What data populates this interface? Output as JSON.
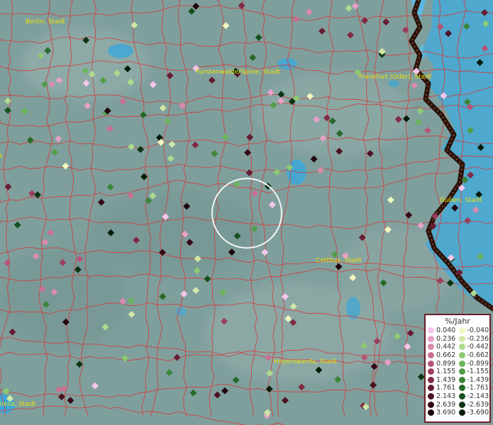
{
  "map": {
    "colors": {
      "land": "#7f9f9c",
      "water": "#3aa6d6",
      "boundary": "#d43b3b",
      "city_label": "#e8e010",
      "border_line": "#3a1810"
    },
    "city_labels": [
      {
        "name": "Berlin, Stadt"
      },
      {
        "name": "Fürstenwalde/Spree, Stadt"
      },
      {
        "name": "Frankfurt (Oder), Stadt"
      },
      {
        "name": "Guben, Stadt"
      },
      {
        "name": "Cottbus, Stadt"
      },
      {
        "name": "Hoyerswerda, Stadt"
      },
      {
        "name": "Riesa, Stadt"
      },
      {
        "name": "t"
      }
    ],
    "search_circle": {
      "style": "white ring"
    },
    "legend": {
      "title": "%/Jahr",
      "positive": [
        {
          "value": "0.040",
          "color": "#f7c6ec"
        },
        {
          "value": "0.236",
          "color": "#e6a0c7"
        },
        {
          "value": "0.442",
          "color": "#d98cb0"
        },
        {
          "value": "0.662",
          "color": "#c86f93"
        },
        {
          "value": "0.899",
          "color": "#b45578"
        },
        {
          "value": "1.155",
          "color": "#9c3e5e"
        },
        {
          "value": "1.439",
          "color": "#812a46"
        },
        {
          "value": "1.761",
          "color": "#661c33"
        },
        {
          "value": "2.143",
          "color": "#4c1123"
        },
        {
          "value": "2.639",
          "color": "#330816"
        },
        {
          "value": "3.690",
          "color": "#1d030a"
        }
      ],
      "negative": [
        {
          "value": "-0.040",
          "color": "#f1f7c0"
        },
        {
          "value": "-0.236",
          "color": "#cfe8a6"
        },
        {
          "value": "-0.442",
          "color": "#aedb8e"
        },
        {
          "value": "-0.662",
          "color": "#8dca73"
        },
        {
          "value": "-0.899",
          "color": "#6cb45d"
        },
        {
          "value": "-1.155",
          "color": "#529e4a"
        },
        {
          "value": "-1.439",
          "color": "#3b8539"
        },
        {
          "value": "-1.761",
          "color": "#276a2a"
        },
        {
          "value": "-2.143",
          "color": "#175020"
        },
        {
          "value": "-2.639",
          "color": "#0b3514"
        },
        {
          "value": "-3.690",
          "color": "#041c08"
        }
      ]
    }
  }
}
